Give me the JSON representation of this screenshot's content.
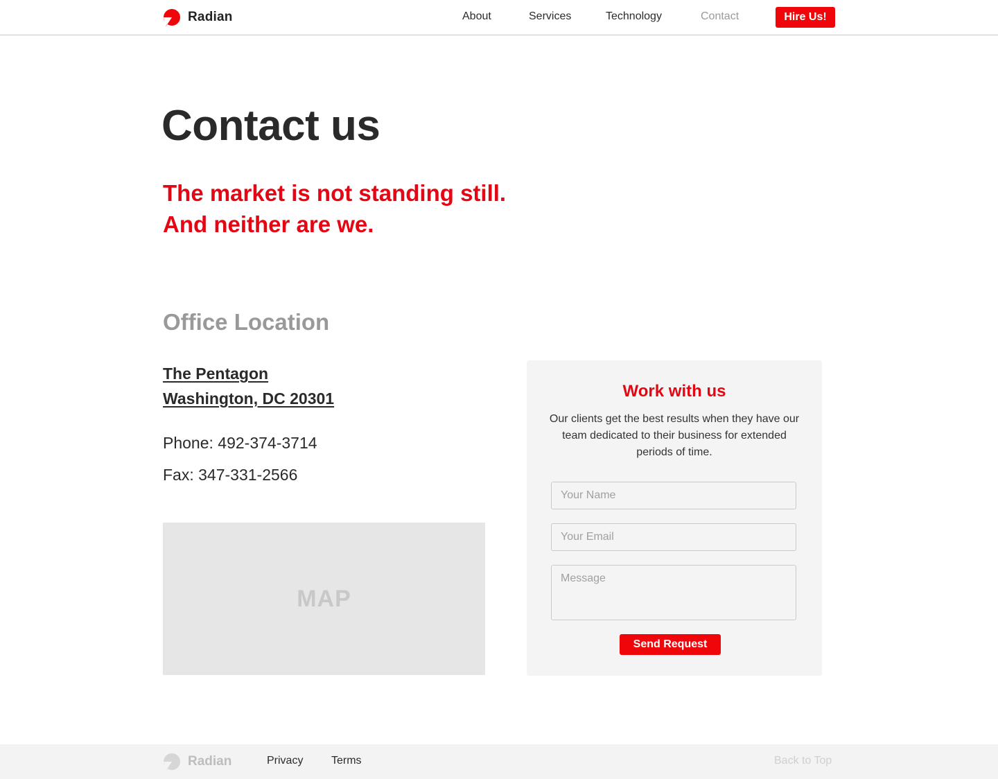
{
  "brand": {
    "name": "Radian",
    "logo_icon": "radian-logo-icon",
    "accent_color": "#f0050a"
  },
  "nav": {
    "items": [
      {
        "label": "About",
        "active": false
      },
      {
        "label": "Services",
        "active": false
      },
      {
        "label": "Technology",
        "active": false
      },
      {
        "label": "Contact",
        "active": true
      }
    ],
    "cta_label": "Hire Us!"
  },
  "hero": {
    "title": "Contact us",
    "tagline_line1": "The market is not standing still.",
    "tagline_line2": "And neither are we."
  },
  "office": {
    "heading": "Office Location",
    "address_line1": "The Pentagon",
    "address_line2": "Washington, DC 20301",
    "phone": "Phone: 492-374-3714",
    "fax": "Fax: 347-331-2566",
    "map_label": "MAP"
  },
  "form": {
    "title": "Work with us",
    "description": "Our clients get the best results when they have our team dedicated to their business for extended periods of time.",
    "name_placeholder": "Your Name",
    "email_placeholder": "Your Email",
    "message_placeholder": "Message",
    "submit_label": "Send Request"
  },
  "footer": {
    "brand_name": "Radian",
    "links": [
      "Privacy",
      "Terms"
    ],
    "back_to_top": "Back to Top"
  }
}
